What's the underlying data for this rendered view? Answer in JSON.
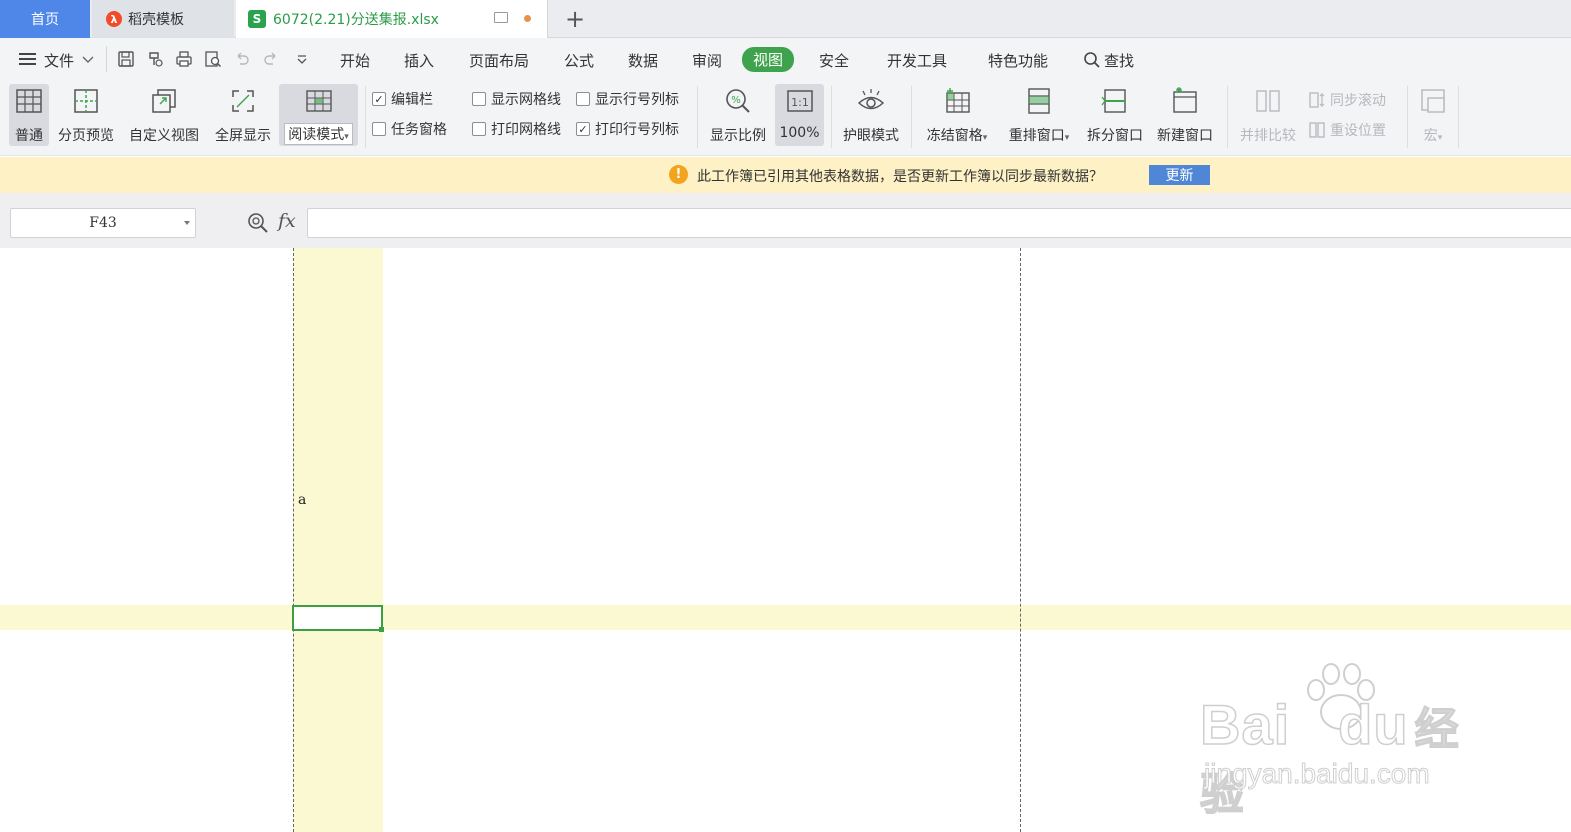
{
  "tabs": {
    "home": "首页",
    "daoke": "稻壳模板",
    "file": "6072(2.21)分送集报.xlsx",
    "add": "+"
  },
  "menu": {
    "file": "文件",
    "items": [
      "开始",
      "插入",
      "页面布局",
      "公式",
      "数据",
      "审阅",
      "视图",
      "安全",
      "开发工具",
      "特色功能"
    ],
    "search": "查找"
  },
  "ribbon": {
    "normal": "普通",
    "page_preview": "分页预览",
    "custom_view": "自定义视图",
    "fullscreen": "全屏显示",
    "read_mode": "阅读模式",
    "edit_bar": "编辑栏",
    "task_pane": "任务窗格",
    "show_grid": "显示网格线",
    "print_grid": "打印网格线",
    "show_headers": "显示行号列标",
    "print_headers": "打印行号列标",
    "zoom": "显示比例",
    "zoom_100": "100%",
    "eye_care": "护眼模式",
    "freeze": "冻结窗格",
    "arrange": "重排窗口",
    "split": "拆分窗口",
    "new_window": "新建窗口",
    "side_by_side": "并排比较",
    "sync_scroll": "同步滚动",
    "reset_pos": "重设位置",
    "macro": "宏"
  },
  "checks": {
    "edit_bar": true,
    "task_pane": false,
    "show_grid": false,
    "print_grid": false,
    "show_headers": false,
    "print_headers": true
  },
  "notice": {
    "text": "此工作簿已引用其他表格数据，是否更新工作簿以同步最新数据？",
    "button": "更新"
  },
  "formula": {
    "cell_ref": "F43",
    "fx": "fx",
    "value": ""
  },
  "sheet": {
    "cell_text": "a"
  },
  "watermark": {
    "logo": "Bai",
    "logo2": "du",
    "cn": "经验",
    "url": "jingyan.baidu.com"
  },
  "colors": {
    "accent": "#3fa34d",
    "home_tab": "#4f87e8",
    "highlight": "#fbf9d2",
    "notice_bg": "#fdf1c5"
  }
}
